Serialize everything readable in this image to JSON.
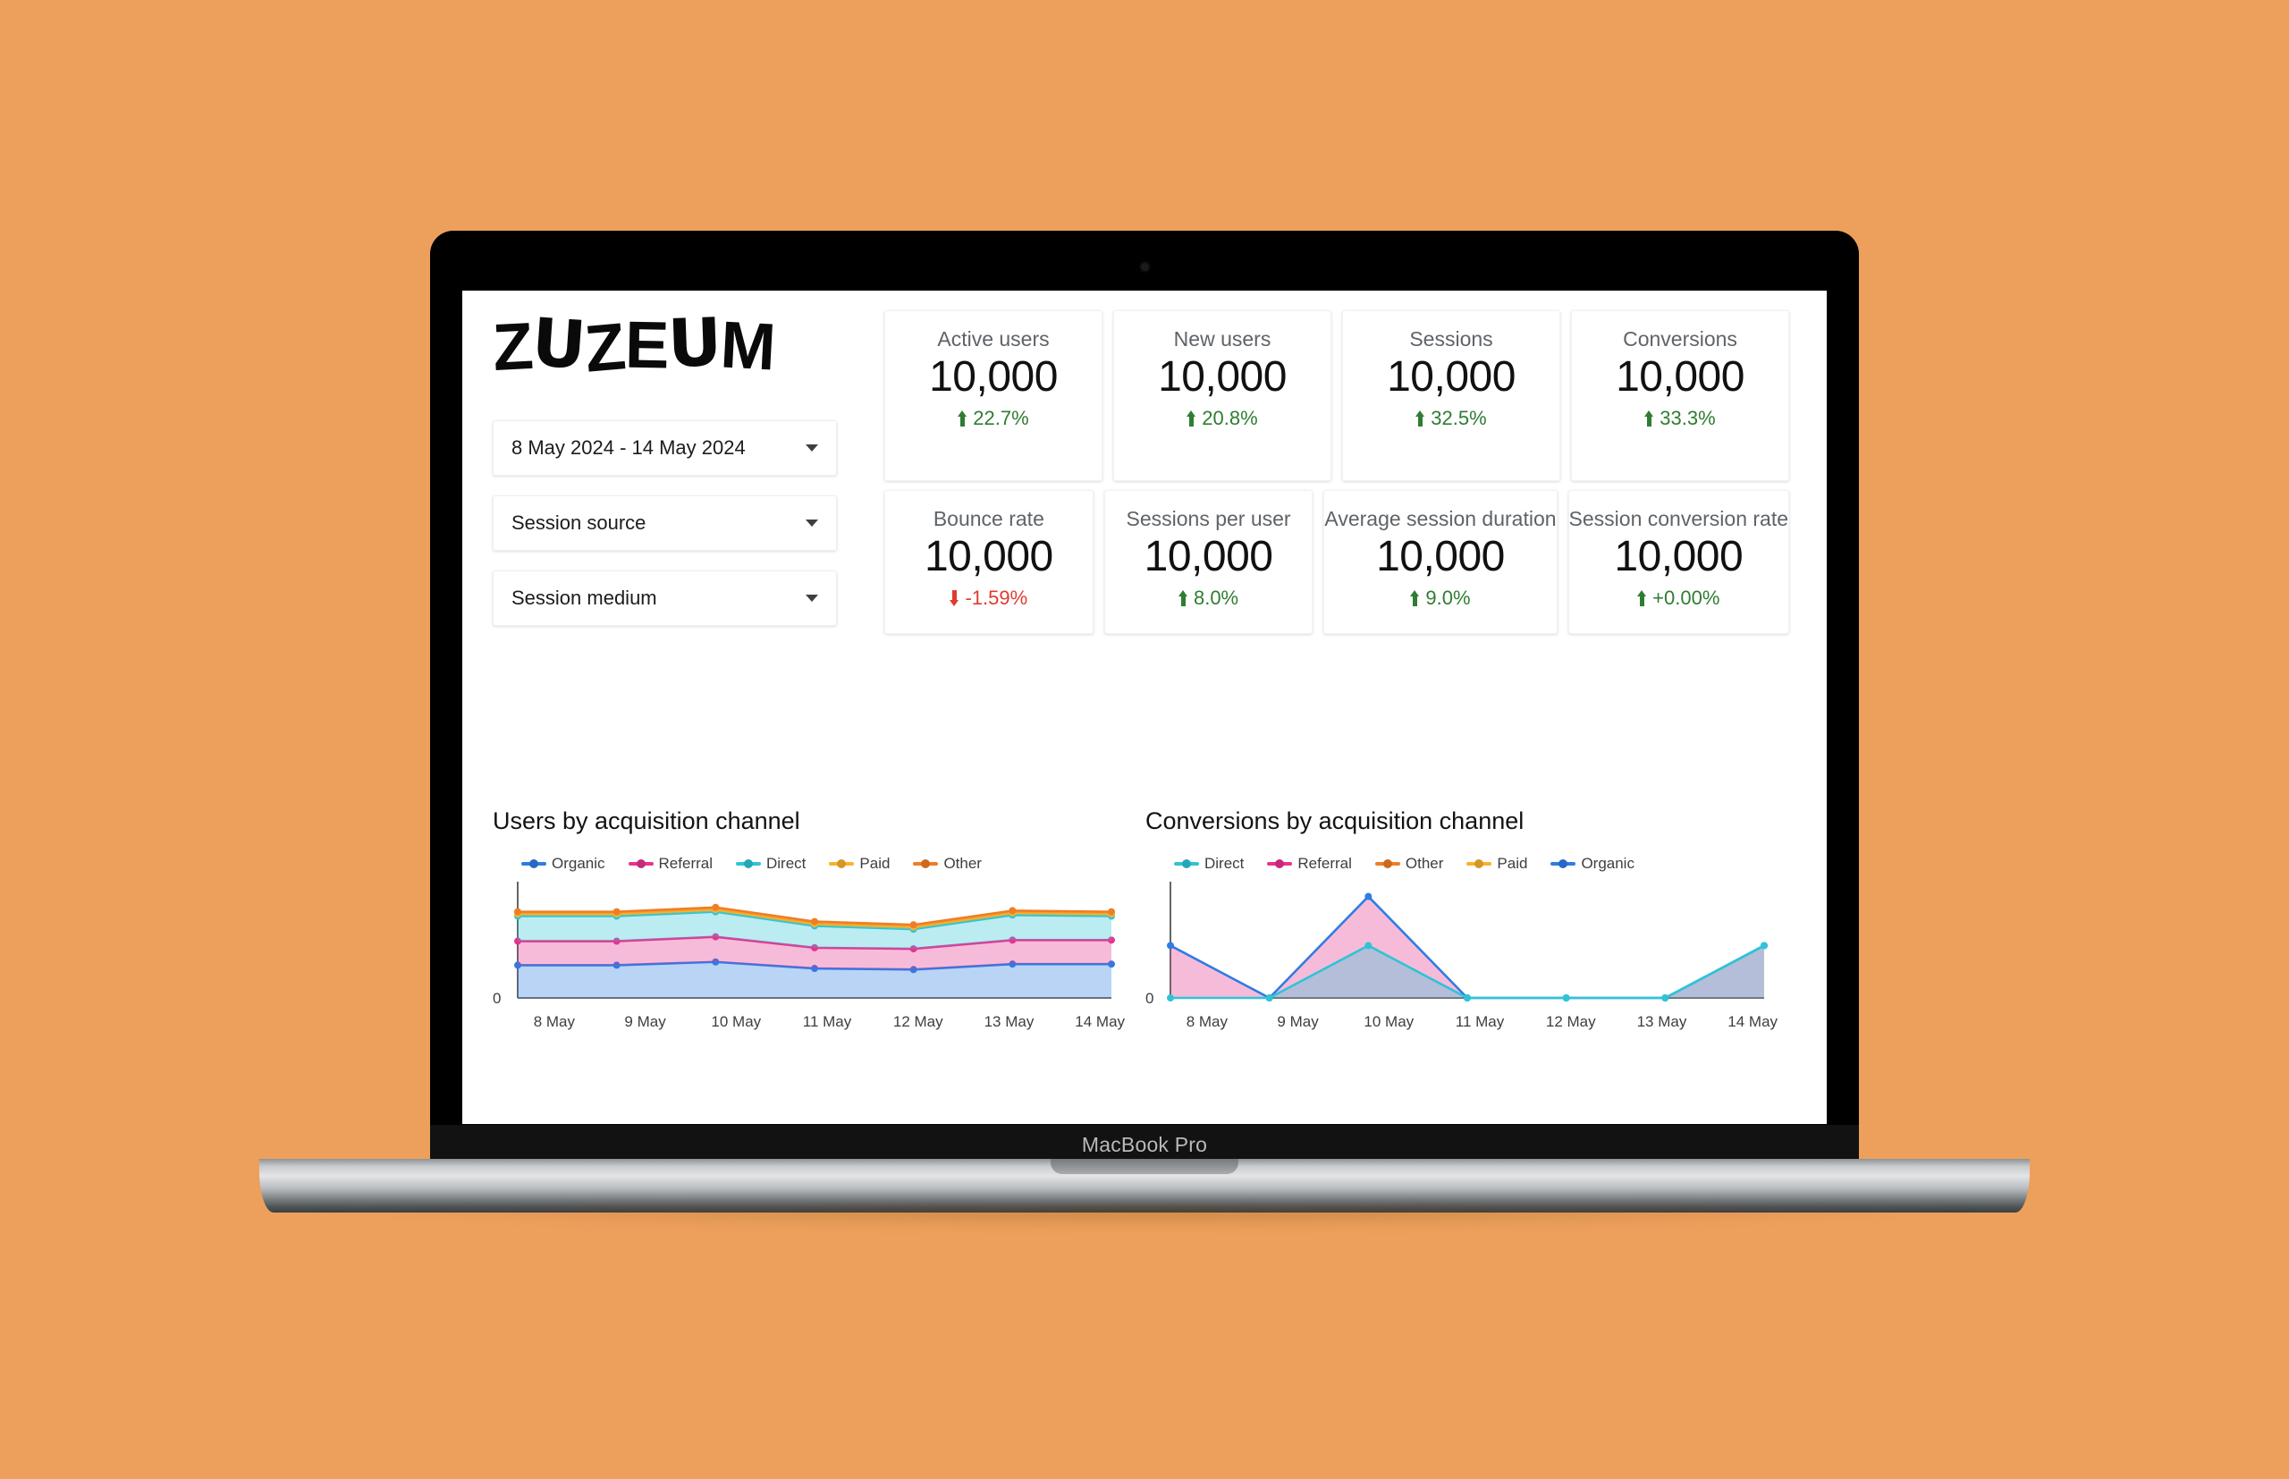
{
  "device": {
    "model_label": "MacBook Pro"
  },
  "background_color": "#eda05c",
  "brand": {
    "logo_letters": [
      "Z",
      "U",
      "Z",
      "E",
      "U",
      "M"
    ],
    "logo_text": "ZUZEUM"
  },
  "filters": [
    {
      "name": "date-range",
      "value": "8 May 2024 - 14 May 2024"
    },
    {
      "name": "session-source",
      "value": "Session source"
    },
    {
      "name": "session-medium",
      "value": "Session medium"
    }
  ],
  "kpis": {
    "row1": [
      {
        "label": "Active users",
        "value": "10,000",
        "delta": "22.7%",
        "direction": "up"
      },
      {
        "label": "New users",
        "value": "10,000",
        "delta": "20.8%",
        "direction": "up"
      },
      {
        "label": "Sessions",
        "value": "10,000",
        "delta": "32.5%",
        "direction": "up"
      },
      {
        "label": "Conversions",
        "value": "10,000",
        "delta": "33.3%",
        "direction": "up"
      }
    ],
    "row2": [
      {
        "label": "Bounce rate",
        "value": "10,000",
        "delta": "-1.59%",
        "direction": "down"
      },
      {
        "label": "Sessions per user",
        "value": "10,000",
        "delta": "8.0%",
        "direction": "up"
      },
      {
        "label": "Average session duration",
        "value": "10,000",
        "delta": "9.0%",
        "direction": "up"
      },
      {
        "label": "Session conversion rate",
        "value": "10,000",
        "delta": "+0.00%",
        "direction": "up"
      }
    ]
  },
  "colors": {
    "organic": "#2e7ce4",
    "referral": "#e8328f",
    "direct": "#2ec4d6",
    "paid": "#f7b32b",
    "other": "#f07d24",
    "positive": "#2f7d32",
    "negative": "#e03b2f"
  },
  "chart_data": [
    {
      "type": "area",
      "title": "Users by acquisition channel",
      "stacked": true,
      "xlabel": "",
      "ylabel": "",
      "ylim": [
        0,
        100
      ],
      "grid": false,
      "legend_position": "top",
      "x": [
        "8 May",
        "9 May",
        "10 May",
        "11 May",
        "12 May",
        "13 May",
        "14 May"
      ],
      "legend": [
        "Organic",
        "Referral",
        "Direct",
        "Paid",
        "Other"
      ],
      "series": [
        {
          "name": "Organic",
          "color": "#2e7ce4",
          "values": [
            30,
            30,
            33,
            27,
            26,
            31,
            31
          ]
        },
        {
          "name": "Referral",
          "color": "#e8328f",
          "values": [
            22,
            22,
            23,
            19,
            19,
            22,
            22
          ]
        },
        {
          "name": "Direct",
          "color": "#2ec4d6",
          "values": [
            23,
            23,
            23,
            20,
            18,
            23,
            22
          ]
        },
        {
          "name": "Paid",
          "color": "#f7b32b",
          "values": [
            2,
            2,
            2,
            2,
            2,
            2,
            2
          ]
        },
        {
          "name": "Other",
          "color": "#f07d24",
          "values": [
            2,
            2,
            2,
            2,
            2,
            2,
            2
          ]
        }
      ]
    },
    {
      "type": "area",
      "title": "Conversions by acquisition channel",
      "stacked": false,
      "xlabel": "",
      "ylabel": "",
      "ylim": [
        0,
        100
      ],
      "grid": false,
      "legend_position": "top",
      "x": [
        "8 May",
        "9 May",
        "10 May",
        "11 May",
        "12 May",
        "13 May",
        "14 May"
      ],
      "legend": [
        "Direct",
        "Referral",
        "Other",
        "Paid",
        "Organic"
      ],
      "series": [
        {
          "name": "Organic",
          "color": "#2e7ce4",
          "values": [
            48,
            0,
            93,
            0,
            0,
            0,
            48
          ]
        },
        {
          "name": "Direct",
          "color": "#2ec4d6",
          "values": [
            0,
            0,
            48,
            0,
            0,
            0,
            48
          ]
        },
        {
          "name": "Referral",
          "color": "#e8328f",
          "values": [
            0,
            0,
            0,
            0,
            0,
            0,
            0
          ]
        },
        {
          "name": "Other",
          "color": "#f07d24",
          "values": [
            0,
            0,
            0,
            0,
            0,
            0,
            0
          ]
        },
        {
          "name": "Paid",
          "color": "#f7b32b",
          "values": [
            0,
            0,
            0,
            0,
            0,
            0,
            0
          ]
        }
      ]
    }
  ],
  "axis": {
    "zero_label": "0"
  }
}
